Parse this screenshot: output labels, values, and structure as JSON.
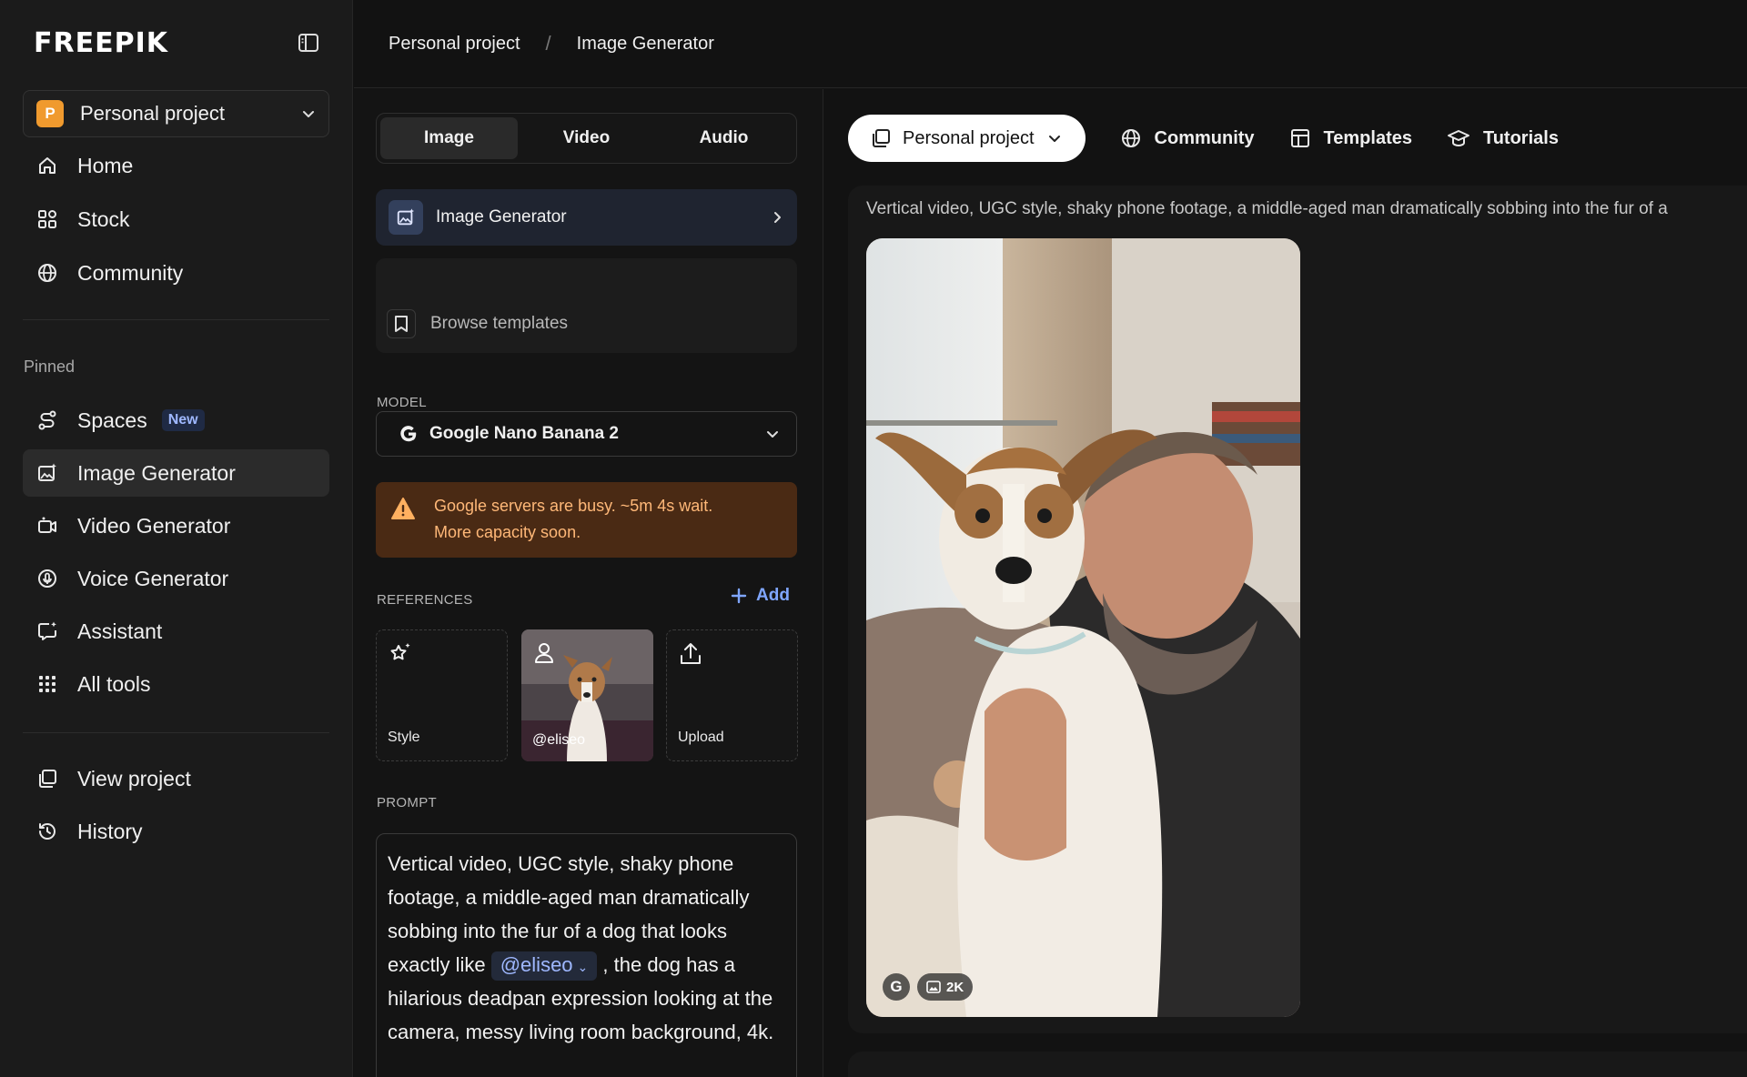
{
  "app": {
    "logo": "FREEPIK"
  },
  "sidebar": {
    "project": {
      "badge": "P",
      "name": "Personal project"
    },
    "nav": [
      {
        "label": "Home",
        "icon": "home-icon"
      },
      {
        "label": "Stock",
        "icon": "grid-icon"
      },
      {
        "label": "Community",
        "icon": "globe-icon"
      }
    ],
    "pinned_title": "Pinned",
    "pinned": [
      {
        "label": "Spaces",
        "icon": "spaces-icon",
        "badge": "New"
      },
      {
        "label": "Image Generator",
        "icon": "image-generator-icon",
        "active": true
      },
      {
        "label": "Video Generator",
        "icon": "video-generator-icon"
      },
      {
        "label": "Voice Generator",
        "icon": "voice-generator-icon"
      },
      {
        "label": "Assistant",
        "icon": "assistant-icon"
      },
      {
        "label": "All tools",
        "icon": "apps-grid-icon"
      }
    ],
    "bottom": [
      {
        "label": "View project",
        "icon": "project-icon"
      },
      {
        "label": "History",
        "icon": "history-icon"
      }
    ]
  },
  "breadcrumb": {
    "project": "Personal project",
    "separator": "/",
    "page": "Image Generator"
  },
  "panel": {
    "tabs": [
      "Image",
      "Video",
      "Audio"
    ],
    "active_tab": "Image",
    "tool": {
      "label": "Image Generator"
    },
    "templates_label": "Browse templates",
    "model_label": "MODEL",
    "model": {
      "name": "Google Nano Banana 2"
    },
    "warning": {
      "line1": "Google servers are busy. ~5m 4s wait.",
      "line2": "More capacity soon."
    },
    "references_label": "REFERENCES",
    "add_label": "Add",
    "references": {
      "style": "Style",
      "photo": "@eliseo",
      "upload": "Upload"
    },
    "prompt_label": "PROMPT",
    "prompt": {
      "before": "Vertical video, UGC style, shaky phone footage, a middle-aged man dramatically sobbing into the fur of a dog that looks exactly like",
      "mention": "@eliseo",
      "after": ", the dog has a hilarious deadpan expression looking at the camera, messy living room background, 4k."
    }
  },
  "main": {
    "project_select": "Personal project",
    "tabs": [
      {
        "label": "Community",
        "icon": "globe-icon"
      },
      {
        "label": "Templates",
        "icon": "templates-icon"
      },
      {
        "label": "Tutorials",
        "icon": "graduation-cap-icon"
      }
    ],
    "result": {
      "caption": "Vertical video, UGC style, shaky phone footage, a middle-aged man dramatically sobbing into the fur of a",
      "model_badge": "G",
      "resolution": "2K"
    }
  },
  "colors": {
    "accent_blue": "#7fa6ff",
    "warning_bg": "#4a2a14",
    "warning_text": "#ffb878",
    "project_badge": "#f09a2e"
  }
}
